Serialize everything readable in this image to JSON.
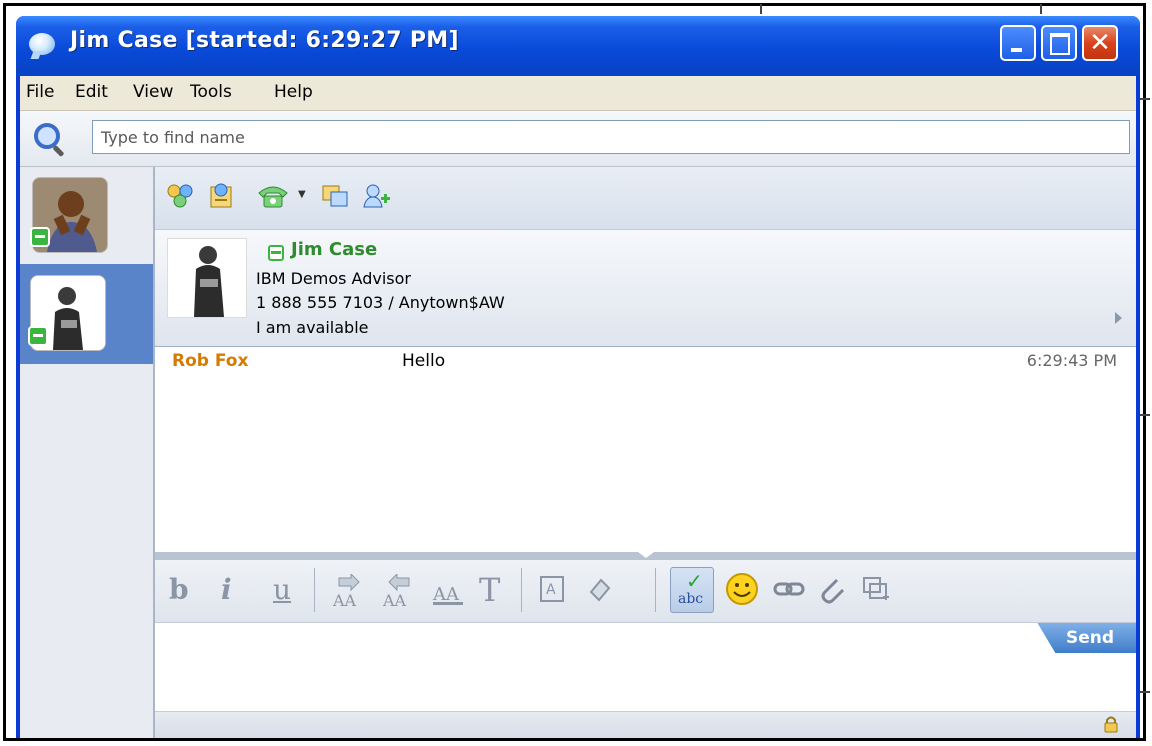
{
  "window": {
    "title": "Jim Case [started: 6:29:27 PM]"
  },
  "menu": [
    "File",
    "Edit",
    "View",
    "Tools",
    "Help"
  ],
  "search": {
    "placeholder": "Type to find name",
    "value": ""
  },
  "contact": {
    "name": "Jim Case",
    "title": "IBM Demos Advisor",
    "phone_location": "1 888 555 7103 / Anytown$AW",
    "status_message": "I am available"
  },
  "transcript": [
    {
      "sender": "Rob Fox",
      "text": "Hello",
      "time": "6:29:43 PM"
    }
  ],
  "format_buttons": {
    "bold": "b",
    "italic": "i",
    "underline": "u",
    "font": "T"
  },
  "send_label": "Send",
  "colors": {
    "title_bar": "#0a4ad9",
    "contact_name": "#2e8b2e",
    "sender_name": "#d47b00",
    "status_online": "#39b540",
    "send_button": "#3f7dcb"
  },
  "icons": {
    "toolbar": [
      "invite-others-icon",
      "share-contact-icon",
      "phone-icon",
      "dropdown-icon",
      "screen-share-icon",
      "add-contact-icon"
    ],
    "format": [
      "bold-icon",
      "italic-icon",
      "underline-icon",
      "increase-font-icon",
      "decrease-font-icon",
      "font-color-icon",
      "font-icon",
      "text-box-icon",
      "highlight-icon",
      "spell-check-icon",
      "emoticon-icon",
      "link-icon",
      "attach-icon",
      "screen-capture-icon"
    ],
    "status": "lock-icon"
  }
}
